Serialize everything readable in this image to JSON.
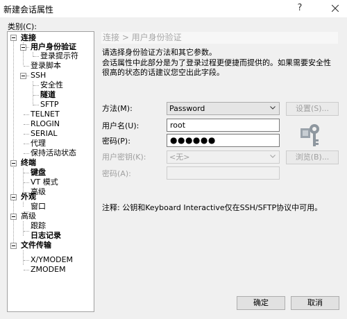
{
  "window": {
    "title": "新建会话属性",
    "help_icon": "?"
  },
  "category_label": "类别(C):",
  "tree": [
    {
      "label": "连接",
      "bold": true
    },
    {
      "label": "用户身份验证",
      "bold": true
    },
    {
      "label": "登录提示符",
      "bold": false
    },
    {
      "label": "登录脚本",
      "bold": false
    },
    {
      "label": "SSH",
      "bold": false
    },
    {
      "label": "安全性",
      "bold": false
    },
    {
      "label": "隧道",
      "bold": true
    },
    {
      "label": "SFTP",
      "bold": false
    },
    {
      "label": "TELNET",
      "bold": false
    },
    {
      "label": "RLOGIN",
      "bold": false
    },
    {
      "label": "SERIAL",
      "bold": false
    },
    {
      "label": "代理",
      "bold": false
    },
    {
      "label": "保持活动状态",
      "bold": false
    },
    {
      "label": "终端",
      "bold": true
    },
    {
      "label": "键盘",
      "bold": true
    },
    {
      "label": "VT 模式",
      "bold": false
    },
    {
      "label": "高级",
      "bold": false
    },
    {
      "label": "外观",
      "bold": true
    },
    {
      "label": "窗口",
      "bold": false
    },
    {
      "label": "高级",
      "bold": false
    },
    {
      "label": "跟踪",
      "bold": false
    },
    {
      "label": "日志记录",
      "bold": true
    },
    {
      "label": "文件传输",
      "bold": true
    },
    {
      "label": "X/YMODEM",
      "bold": false
    },
    {
      "label": "ZMODEM",
      "bold": false
    }
  ],
  "panel": {
    "breadcrumb": "连接 > 用户身份验证",
    "desc1": "请选择身份验证方法和其它参数。",
    "desc2": "会话属性中此部分是为了登录过程更便捷而提供的。如果需要安全性",
    "desc3": "很高的状态的话建议您空出此字段。",
    "method_label": "方法(M):",
    "method_value": "Password",
    "settings_button": "设置(S)...",
    "username_label": "用户名(U):",
    "username_value": "root",
    "password_label": "密码(P):",
    "password_value": "●●●●●●",
    "userkey_label": "用户密钥(K):",
    "userkey_value": "<无>",
    "browse_button": "浏览(B)...",
    "passphrase_label": "密码(A):",
    "note": "注释: 公钥和Keyboard Interactive仅在SSH/SFTP协议中可用。"
  },
  "footer": {
    "ok": "确定",
    "cancel": "取消"
  }
}
